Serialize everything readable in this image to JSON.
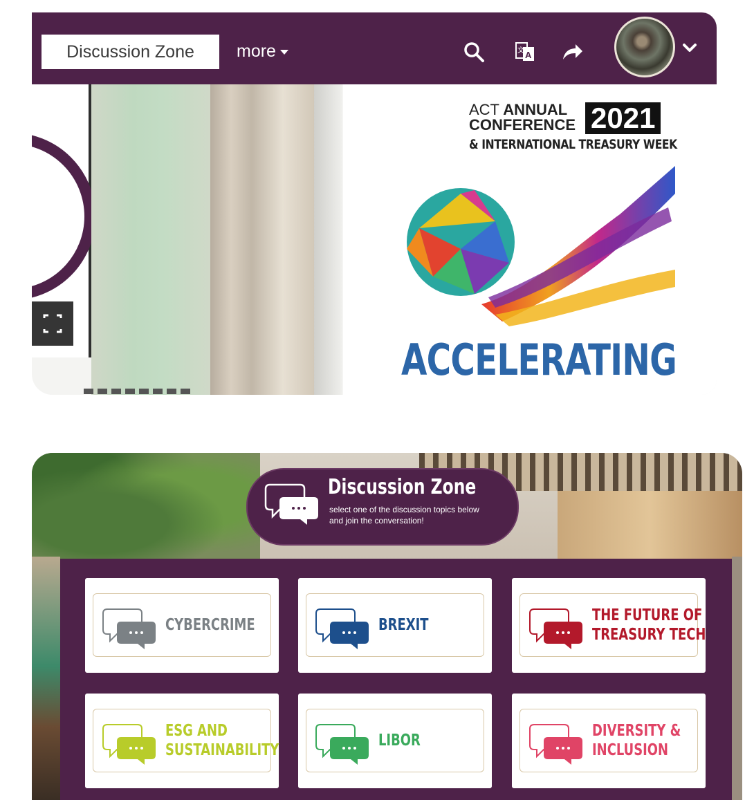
{
  "navbar": {
    "active_tab": "Discussion Zone",
    "more_label": "more",
    "icons": [
      "search-icon",
      "translate-icon",
      "share-icon",
      "chevron-down-icon"
    ]
  },
  "poster": {
    "act": "ACT",
    "annual": "ANNUAL",
    "conference": "CONFERENCE",
    "year": "2021",
    "subtitle": "& INTERNATIONAL TREASURY WEEK",
    "headline": "ACCELERATING"
  },
  "discussion_zone": {
    "title": "Discussion Zone",
    "subtitle": "select one of the discussion topics below and join the conversation!"
  },
  "topics": [
    {
      "label": "CYBERCRIME",
      "color": "#7b8185"
    },
    {
      "label": "BREXIT",
      "color": "#1d4f8c"
    },
    {
      "label_line1": "THE FUTURE OF",
      "label_line2": "TREASURY TECH",
      "color": "#b3192b"
    },
    {
      "label_line1": "ESG AND",
      "label_line2": "SUSTAINABILITY",
      "color": "#b8cc2a"
    },
    {
      "label": "LIBOR",
      "color": "#3aaa5c"
    },
    {
      "label_line1": "DIVERSITY &",
      "label_line2": "INCLUSION",
      "color": "#e04466"
    }
  ],
  "colors": {
    "brand_purple": "#4e2249"
  }
}
